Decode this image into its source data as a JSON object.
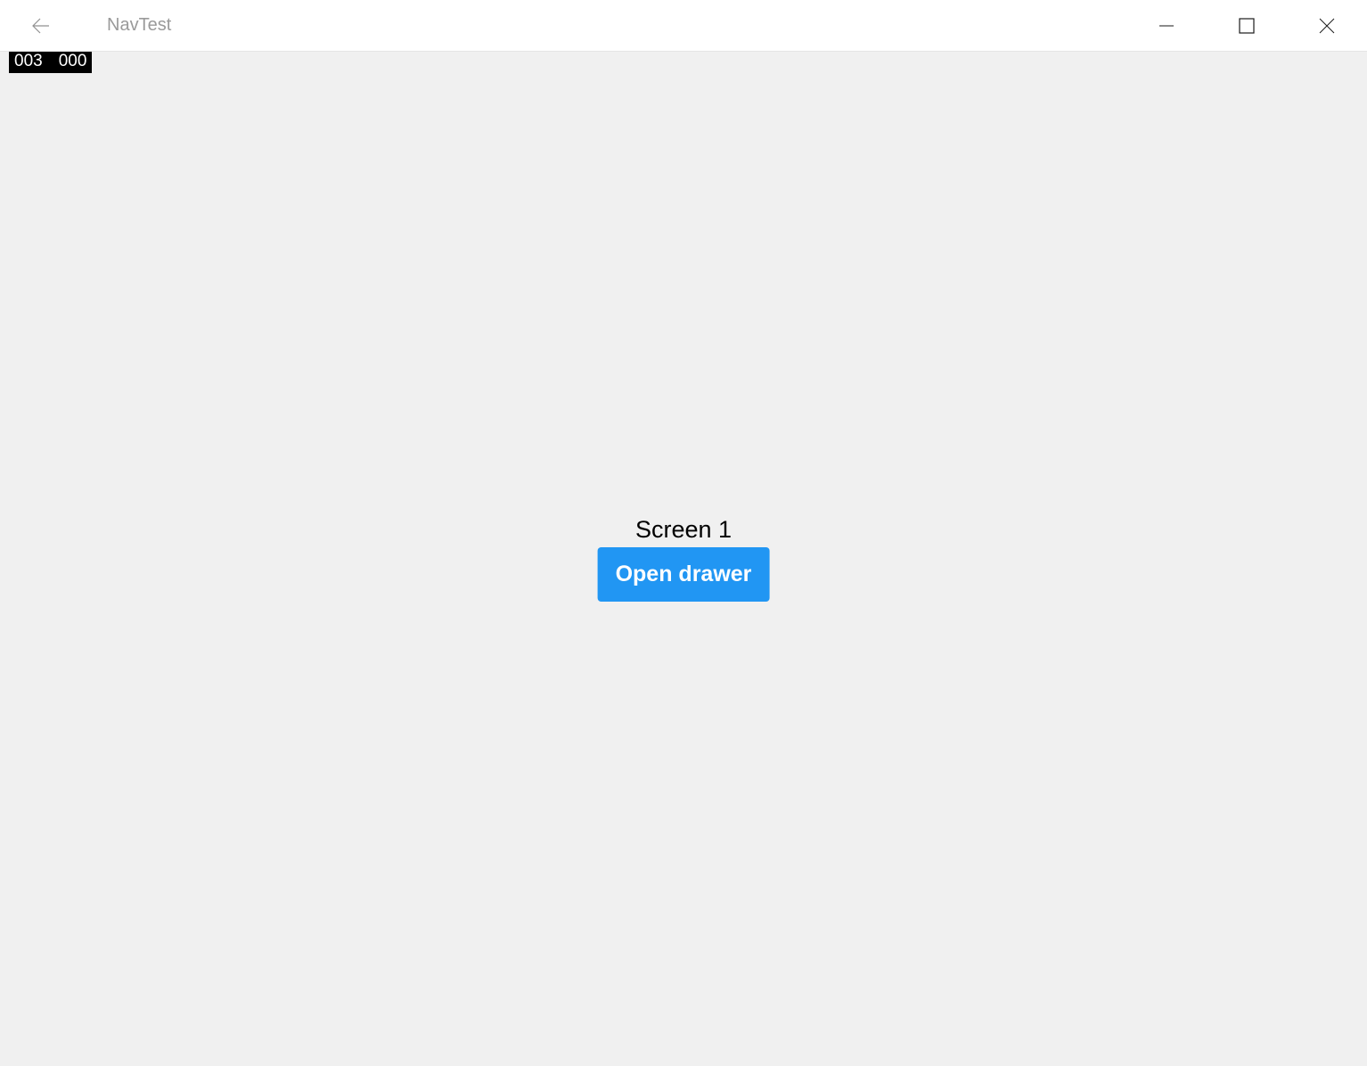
{
  "window": {
    "title": "NavTest"
  },
  "debug": {
    "counter1": "003",
    "counter2": "000"
  },
  "main": {
    "screen_title": "Screen 1",
    "open_drawer_label": "Open drawer"
  }
}
